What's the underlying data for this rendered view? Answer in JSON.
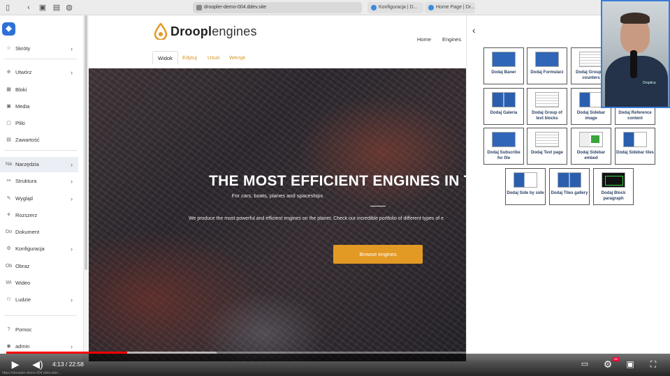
{
  "browser": {
    "url": "droopler-demo-004.ddev.site",
    "tabs": [
      "Konfiguracja | D...",
      "Home Page | Dr..."
    ]
  },
  "admin": {
    "items": [
      {
        "icon": "☆",
        "label": "Skróty",
        "chevron": true
      },
      {
        "icon": "⊕",
        "label": "Utwórz",
        "chevron": true
      },
      {
        "icon": "▦",
        "label": "Bloki",
        "chevron": false
      },
      {
        "icon": "▣",
        "label": "Media",
        "chevron": false
      },
      {
        "icon": "▢",
        "label": "Pliki",
        "chevron": false
      },
      {
        "icon": "▤",
        "label": "Zawartość",
        "chevron": false
      },
      {
        "icon": "Na",
        "label": "Narzędzia",
        "chevron": true
      },
      {
        "icon": "⚯",
        "label": "Struktura",
        "chevron": true
      },
      {
        "icon": "✎",
        "label": "Wygląd",
        "chevron": true
      },
      {
        "icon": "⚘",
        "label": "Rozszerz",
        "chevron": false
      },
      {
        "icon": "Do",
        "label": "Dokument",
        "chevron": false
      },
      {
        "icon": "⚙",
        "label": "Konfiguracja",
        "chevron": true
      },
      {
        "icon": "Ob",
        "label": "Obraz",
        "chevron": false
      },
      {
        "icon": "Wi",
        "label": "Wideo",
        "chevron": false
      },
      {
        "icon": "⚇",
        "label": "Ludzie",
        "chevron": true
      },
      {
        "icon": "?",
        "label": "Pomoc",
        "chevron": false
      },
      {
        "icon": "◉",
        "label": "admin",
        "chevron": true
      }
    ]
  },
  "site": {
    "logo_bold": "Droopl",
    "logo_rest": "engines",
    "nav": [
      "Home",
      "Engines"
    ],
    "local_tabs": [
      "Widok",
      "Edytuj",
      "Usuń",
      "Wersje"
    ],
    "hero": {
      "title": "THE MOST EFFICIENT ENGINES IN T",
      "subtitle": "For cars, boats, planes and spaceships",
      "text": "We produce the most powerful and efficient engines on the planet. Check our incredible portfolio of different types of e",
      "button": "Browse engines"
    }
  },
  "panel": {
    "back": "‹",
    "blocks": [
      {
        "label": "Dodaj Baner",
        "thumb": "blue"
      },
      {
        "label": "Dodaj Formularz",
        "thumb": "blue"
      },
      {
        "label": "Dodaj Group of counters",
        "thumb": "lines"
      },
      {
        "label": "",
        "thumb": "lines"
      },
      {
        "label": "Dodaj Galeria",
        "thumb": "grid"
      },
      {
        "label": "Dodaj Group of text blocks",
        "thumb": "lines"
      },
      {
        "label": "Dodaj Sidebar image",
        "thumb": "split"
      },
      {
        "label": "Dodaj Reference content",
        "thumb": "lines"
      },
      {
        "label": "Dodaj Subscribe for file",
        "thumb": "blue"
      },
      {
        "label": "Dodaj Text page",
        "thumb": "lines"
      },
      {
        "label": "Dodaj Sidebar embed",
        "thumb": "green"
      },
      {
        "label": "Dodaj Sidebar tiles",
        "thumb": "split"
      },
      {
        "label": "Dodaj Side by side",
        "thumb": "split"
      },
      {
        "label": "Dodaj Tiles gallery",
        "thumb": "grid"
      },
      {
        "label": "Dodaj Block paragraph",
        "thumb": "black"
      }
    ]
  },
  "webcam": {
    "brand": "Droptica"
  },
  "video": {
    "time": "4:13 / 22:58",
    "played_fraction": 0.184,
    "loaded_fraction": 0.32
  },
  "status_url": "https://droopler-demo-004.ddev.site/..."
}
